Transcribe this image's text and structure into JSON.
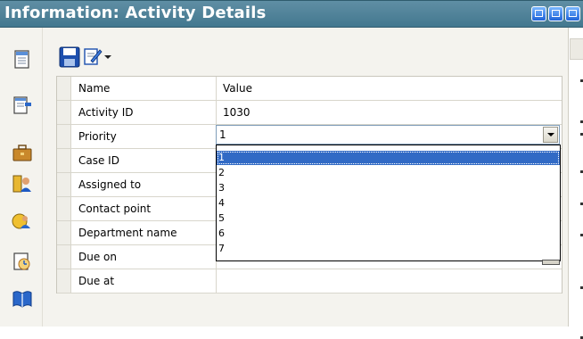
{
  "window": {
    "title": "Information: Activity Details",
    "title_buttons": [
      "restore-icon",
      "next-pane-icon",
      "window-icon"
    ]
  },
  "sidebar": {
    "icons": [
      "notes-icon",
      "activity-details-icon",
      "briefcase-icon",
      "contacts-icon",
      "people-icon",
      "calendar-icon",
      "book-icon"
    ]
  },
  "toolbar": {
    "icons": [
      "save-icon",
      "edit-icon",
      "dropdown-arrow-icon"
    ]
  },
  "grid": {
    "columns": {
      "name": "Name",
      "value": "Value"
    },
    "rows": [
      {
        "name": "Activity ID",
        "value": "1030"
      },
      {
        "name": "Priority",
        "value": "1"
      },
      {
        "name": "Case ID",
        "value": ""
      },
      {
        "name": "Assigned to",
        "value": ""
      },
      {
        "name": "Contact point",
        "value": ""
      },
      {
        "name": "Department name",
        "value": ""
      },
      {
        "name": "Due on",
        "value": ""
      },
      {
        "name": "Due at",
        "value": ""
      }
    ]
  },
  "priority_dropdown": {
    "selected": "1",
    "options": [
      "1",
      "2",
      "3",
      "4",
      "5",
      "6",
      "7"
    ]
  },
  "colors": {
    "titlebar": "#4f86a0",
    "selection": "#316ac5",
    "panel_background": "#f4f3ee"
  }
}
